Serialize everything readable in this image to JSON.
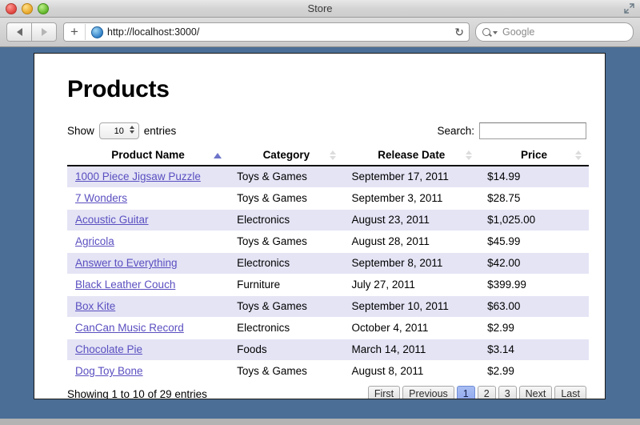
{
  "window": {
    "title": "Store",
    "traffic_lights": [
      "close-red",
      "minimize-yellow",
      "zoom-green"
    ]
  },
  "toolbar": {
    "back_label": "Back",
    "forward_label": "Forward",
    "add_tab_label": "+",
    "url": "http://localhost:3000/",
    "reload_glyph": "↻",
    "search_placeholder": "Google"
  },
  "page": {
    "title": "Products",
    "length": {
      "prefix": "Show",
      "value": "10",
      "suffix": "entries"
    },
    "filter": {
      "label": "Search:",
      "value": "",
      "placeholder": ""
    },
    "columns": [
      {
        "label": "Product Name",
        "sort": "asc"
      },
      {
        "label": "Category",
        "sort": "none"
      },
      {
        "label": "Release Date",
        "sort": "none"
      },
      {
        "label": "Price",
        "sort": "none"
      }
    ],
    "rows": [
      {
        "name": "1000 Piece Jigsaw Puzzle",
        "category": "Toys & Games",
        "date": "September 17, 2011",
        "price": "$14.99"
      },
      {
        "name": "7 Wonders",
        "category": "Toys & Games",
        "date": "September 3, 2011",
        "price": "$28.75"
      },
      {
        "name": "Acoustic Guitar",
        "category": "Electronics",
        "date": "August 23, 2011",
        "price": "$1,025.00"
      },
      {
        "name": "Agricola",
        "category": "Toys & Games",
        "date": "August 28, 2011",
        "price": "$45.99"
      },
      {
        "name": "Answer to Everything",
        "category": "Electronics",
        "date": "September 8, 2011",
        "price": "$42.00"
      },
      {
        "name": "Black Leather Couch",
        "category": "Furniture",
        "date": "July 27, 2011",
        "price": "$399.99"
      },
      {
        "name": "Box Kite",
        "category": "Toys & Games",
        "date": "September 10, 2011",
        "price": "$63.00"
      },
      {
        "name": "CanCan Music Record",
        "category": "Electronics",
        "date": "October 4, 2011",
        "price": "$2.99"
      },
      {
        "name": "Chocolate Pie",
        "category": "Foods",
        "date": "March 14, 2011",
        "price": "$3.14"
      },
      {
        "name": "Dog Toy Bone",
        "category": "Toys & Games",
        "date": "August 8, 2011",
        "price": "$2.99"
      }
    ],
    "info": "Showing 1 to 10 of 29 entries",
    "paging": [
      {
        "label": "First",
        "active": false
      },
      {
        "label": "Previous",
        "active": false
      },
      {
        "label": "1",
        "active": true
      },
      {
        "label": "2",
        "active": false
      },
      {
        "label": "3",
        "active": false
      },
      {
        "label": "Next",
        "active": false
      },
      {
        "label": "Last",
        "active": false
      }
    ]
  },
  "colors": {
    "desktop": "#4a6e96",
    "row_stripe": "#e4e4f5",
    "link": "#5a4fc0",
    "sort_active": "#6d74c9",
    "page_active": "#8ea8ee"
  }
}
